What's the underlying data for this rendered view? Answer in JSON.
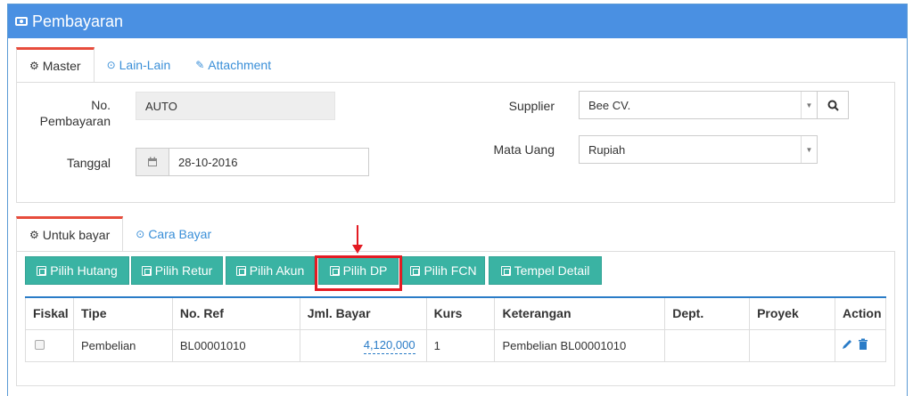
{
  "header": {
    "title": "Pembayaran",
    "icon": "money-icon"
  },
  "tabs_top": [
    {
      "label": "Master",
      "icon": "gears-icon",
      "active": true
    },
    {
      "label": "Lain-Lain",
      "icon": "check-circle-icon",
      "active": false
    },
    {
      "label": "Attachment",
      "icon": "paperclip-icon",
      "active": false
    }
  ],
  "form": {
    "no_label_1": "No.",
    "no_label_2": "Pembayaran",
    "no_value": "AUTO",
    "tanggal_label": "Tanggal",
    "tanggal_value": "28-10-2016",
    "supplier_label": "Supplier",
    "supplier_value": "Bee CV.",
    "mata_uang_label": "Mata Uang",
    "mata_uang_value": "Rupiah"
  },
  "tabs_bottom": [
    {
      "label": "Untuk bayar",
      "icon": "gears-icon",
      "active": true
    },
    {
      "label": "Cara Bayar",
      "icon": "check-circle-icon",
      "active": false
    }
  ],
  "buttons": {
    "pilih_hutang": "Pilih Hutang",
    "pilih_retur": "Pilih Retur",
    "pilih_akun": "Pilih Akun",
    "pilih_dp": "Pilih DP",
    "pilih_fcn": "Pilih FCN",
    "tempel_detail": "Tempel Detail"
  },
  "table": {
    "headers": [
      "Fiskal",
      "Tipe",
      "No. Ref",
      "Jml. Bayar",
      "Kurs",
      "Keterangan",
      "Dept.",
      "Proyek",
      "Action"
    ],
    "rows": [
      {
        "fiskal": "",
        "tipe": "Pembelian",
        "no_ref": "BL00001010",
        "jml_bayar": "4,120,000",
        "kurs": "1",
        "keterangan": "Pembelian BL00001010",
        "dept": "",
        "proyek": ""
      }
    ]
  },
  "colors": {
    "header": "#4a90e2",
    "button": "#3ab3a3",
    "highlight": "#e31b23",
    "link": "#2a7cc7"
  }
}
